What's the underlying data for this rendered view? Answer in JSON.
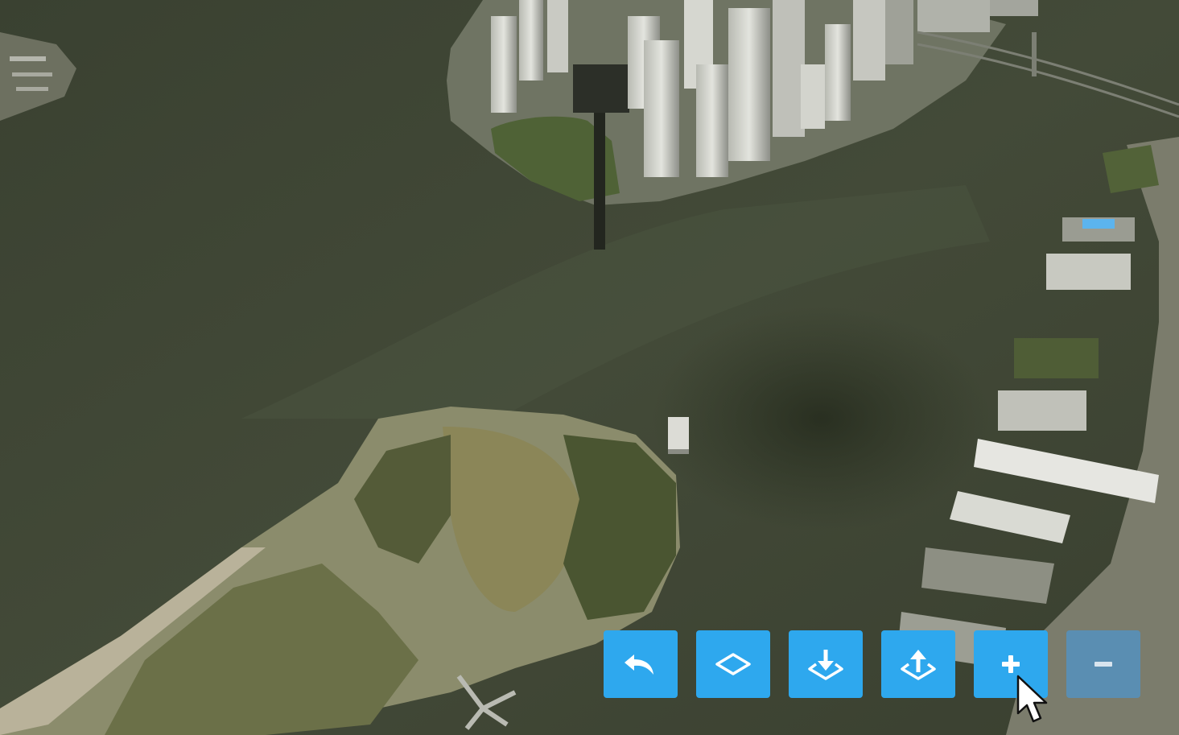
{
  "app": {
    "view": "3d-map-viewer",
    "scene": "aerial-3d-satellite",
    "tool_buttons_disabled": [
      "zoom-out"
    ]
  },
  "toolbar": {
    "buttons": [
      {
        "id": "undo",
        "icon": "undo-arrow-icon",
        "enabled": true
      },
      {
        "id": "draw-area",
        "icon": "diamond-outline-icon",
        "enabled": true
      },
      {
        "id": "lower",
        "icon": "download-tray-icon",
        "enabled": true
      },
      {
        "id": "raise",
        "icon": "upload-tray-icon",
        "enabled": true
      },
      {
        "id": "zoom-in",
        "icon": "plus-icon",
        "enabled": true
      },
      {
        "id": "zoom-out",
        "icon": "minus-icon",
        "enabled": false
      }
    ]
  },
  "colors": {
    "button": "#2ea8ee",
    "button_disabled": "#4e96cd",
    "water": "#3d4432",
    "land": "#8a8b6a"
  },
  "cursor": {
    "icon": "pointer-cursor-icon"
  }
}
